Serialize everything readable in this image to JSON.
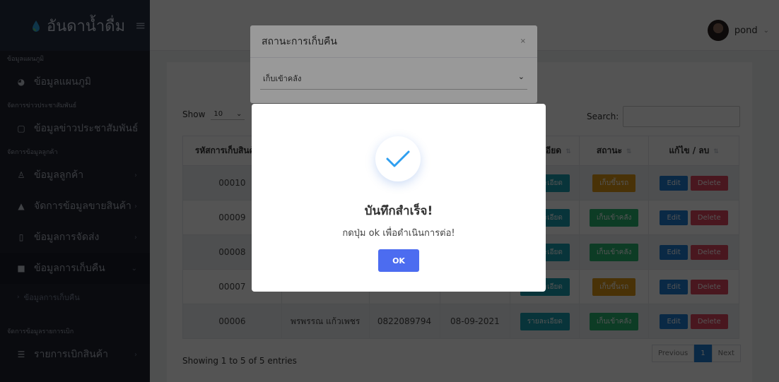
{
  "brand": {
    "name": "อันดาน้ำดื่ม",
    "toggle_icon": "hamburger-icon"
  },
  "sidebar": {
    "sections": [
      {
        "title": "ข้อมูลแผนภูมิ",
        "items": [
          {
            "label": "ข้อมูลแผนภูมิ",
            "icon": "pie-chart-icon",
            "has_chevron": false
          }
        ]
      },
      {
        "title": "จัดการข่าวประชาสัมพันธ์",
        "items": [
          {
            "label": "ข้อมูลข่าวประชาสัมพันธ์",
            "icon": "square-icon",
            "has_chevron": true
          }
        ]
      },
      {
        "title": "จัดการข้อมูลลูกค้า",
        "items": [
          {
            "label": "ข้อมูลลูกค้า",
            "icon": "users-icon",
            "has_chevron": true
          },
          {
            "label": "จัดการข้อมูลขายสินค้า",
            "icon": "shop-icon",
            "has_chevron": true
          },
          {
            "label": "ข้อมูลการจัดส่ง",
            "icon": "box-icon",
            "has_chevron": true
          },
          {
            "label": "ข้อมูลการเก็บคืน",
            "icon": "truck-icon",
            "has_chevron": true,
            "active": true
          }
        ]
      }
    ],
    "sub_item": "ข้อมูลการเก็บคืน",
    "last_section": "จัดการข้อมูลรายการเบิก",
    "last_item": "รายการเบิกสินค้า"
  },
  "header": {
    "username": "pond"
  },
  "table_controls": {
    "show_label": "Show",
    "length_value": "10",
    "search_label": "Search:"
  },
  "table": {
    "columns": [
      "รหัสการเก็บสินค้า",
      "",
      "",
      "",
      "รายละเอียด",
      "สถานะ",
      "แก้ไข / ลบ"
    ],
    "rows": [
      {
        "id": "00010",
        "name": "",
        "phone": "",
        "date": "",
        "status": "เก็บขึ้นรถ",
        "status_type": "orange"
      },
      {
        "id": "00009",
        "name": "",
        "phone": "",
        "date": "",
        "status": "เก็บเข้าคลัง",
        "status_type": "green"
      },
      {
        "id": "00008",
        "name": "",
        "phone": "",
        "date": "",
        "status": "เก็บเข้าคลัง",
        "status_type": "green"
      },
      {
        "id": "00007",
        "name": "",
        "phone": "",
        "date": "",
        "status": "เก็บขึ้นรถ",
        "status_type": "orange"
      },
      {
        "id": "00006",
        "name": "พรพรรณ แก้วเพชร",
        "phone": "0822089794",
        "date": "08-09-2021",
        "status": "เก็บเข้าคลัง",
        "status_type": "green"
      }
    ],
    "detail_label": "รายละเอียด",
    "edit_label": "Edit",
    "delete_label": "Delete"
  },
  "footer": {
    "showing": "Showing 1 to 5 of 5 entries",
    "prev": "Previous",
    "page": "1",
    "next": "Next"
  },
  "status_modal": {
    "title": "สถานะการเก็บคืน",
    "close": "×",
    "selected": "เก็บเข้าคลัง"
  },
  "alert": {
    "title": "บันทึกสำเร็จ!",
    "message": "กดปุ่ม ok เพื่อดำเนินการต่อ!",
    "ok": "OK"
  }
}
